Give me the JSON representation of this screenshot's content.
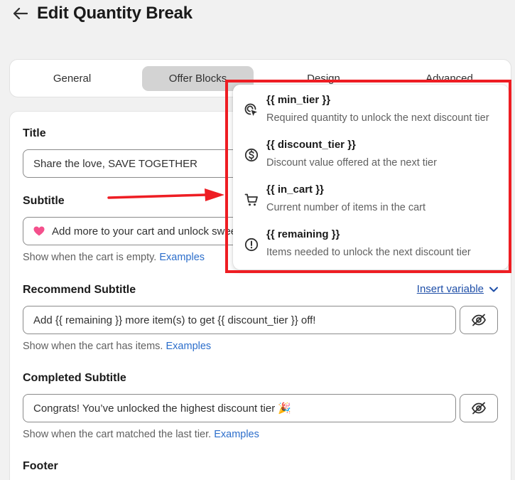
{
  "header": {
    "title": "Edit Quantity Break"
  },
  "tabs": [
    {
      "label": "General"
    },
    {
      "label": "Offer Blocks"
    },
    {
      "label": "Design"
    },
    {
      "label": "Advanced"
    }
  ],
  "fields": {
    "title": {
      "label": "Title",
      "value": "Share the love, SAVE TOGETHER"
    },
    "subtitle": {
      "label": "Subtitle",
      "value": "Add more to your cart and unlock sweet savings",
      "helper": "Show when the cart is empty.",
      "helper_link": "Examples"
    },
    "recommend_subtitle": {
      "label": "Recommend Subtitle",
      "value": "Add {{ remaining }} more item(s) to get {{ discount_tier }} off!",
      "helper": "Show when the cart has items.",
      "helper_link": "Examples"
    },
    "completed_subtitle": {
      "label": "Completed Subtitle",
      "value": "Congrats! You’ve unlocked the highest discount tier 🎉",
      "helper": "Show when the cart matched the last tier.",
      "helper_link": "Examples"
    },
    "footer": {
      "label": "Footer"
    }
  },
  "insert_variable": {
    "label": "Insert variable"
  },
  "dropdown": {
    "items": [
      {
        "title": "{{ min_tier }}",
        "desc": "Required quantity to unlock the next discount tier",
        "icon": "target-cursor-icon"
      },
      {
        "title": "{{ discount_tier }}",
        "desc": "Discount value offered at the next tier",
        "icon": "dollar-circle-icon"
      },
      {
        "title": "{{ in_cart }}",
        "desc": "Current number of items in the cart",
        "icon": "cart-icon"
      },
      {
        "title": "{{ remaining }}",
        "desc": "Items needed to unlock the next discount tier",
        "icon": "alert-circle-icon"
      }
    ]
  },
  "colors": {
    "annotation_red": "#ee1d23",
    "link": "#2c6ecb",
    "active_tab": "#d3d3d3"
  }
}
